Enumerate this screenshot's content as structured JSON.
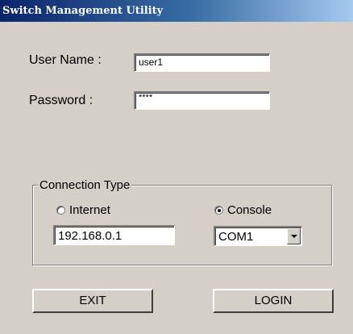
{
  "window": {
    "title": "Switch Management Utility"
  },
  "login": {
    "username_label": "User Name :",
    "username_value": "user1",
    "password_label": "Password :",
    "password_value": "****"
  },
  "connection": {
    "group_label": "Connection Type",
    "internet_label": "Internet",
    "internet_selected": false,
    "console_label": "Console",
    "console_selected": true,
    "ip_value": "192.168.0.1",
    "port_value": "COM1"
  },
  "buttons": {
    "exit_label": "EXIT",
    "login_label": "LOGIN"
  }
}
